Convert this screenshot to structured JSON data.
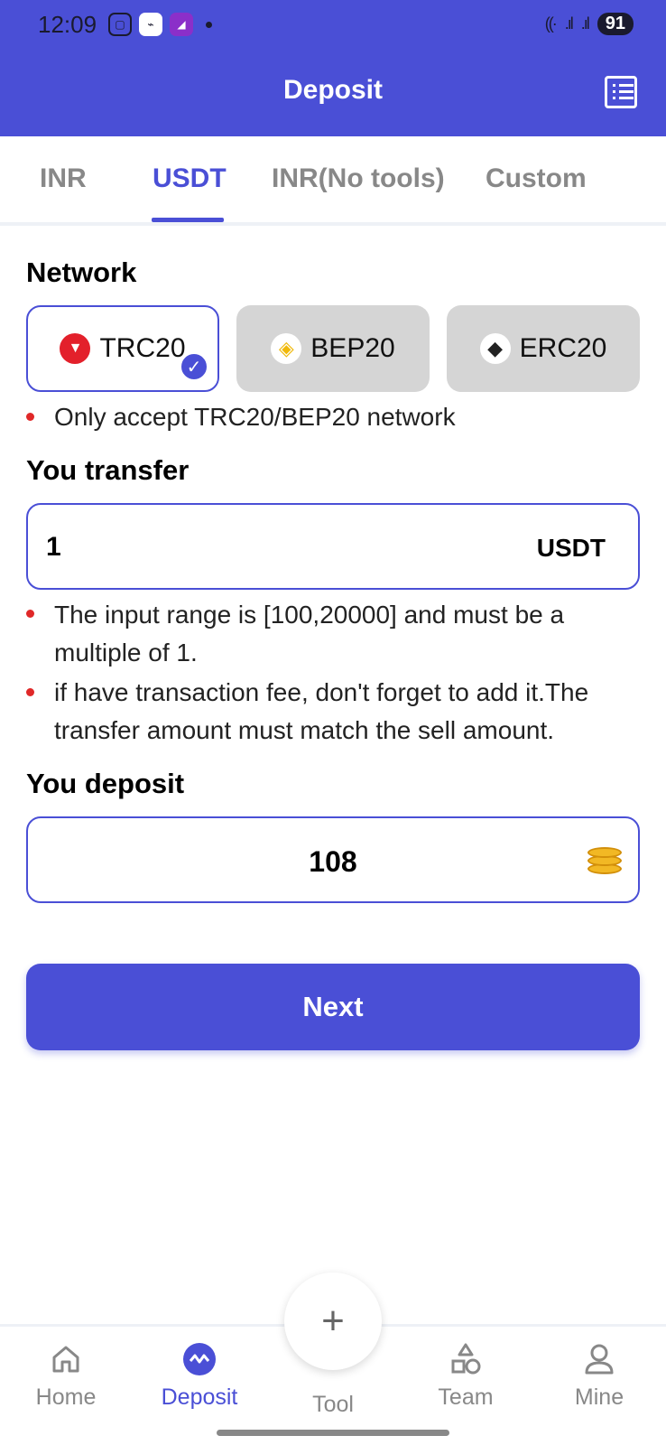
{
  "status_bar": {
    "time": "12:09",
    "battery": "91"
  },
  "header": {
    "title": "Deposit",
    "action_icon": "list-icon"
  },
  "tabs": [
    {
      "label": "INR",
      "active": false
    },
    {
      "label": "USDT",
      "active": true
    },
    {
      "label": "INR(No tools)",
      "active": false
    },
    {
      "label": "Custom",
      "active": false
    }
  ],
  "network": {
    "title": "Network",
    "options": [
      {
        "label": "TRC20",
        "icon": "tron-icon",
        "selected": true
      },
      {
        "label": "BEP20",
        "icon": "bnb-icon",
        "selected": false
      },
      {
        "label": "ERC20",
        "icon": "ethereum-icon",
        "selected": false
      }
    ],
    "note": "Only accept TRC20/BEP20 network"
  },
  "transfer": {
    "title": "You transfer",
    "value": "1",
    "unit": "USDT",
    "notes": [
      "The input range is [100,20000] and must be a multiple of 1.",
      "if have transaction fee, don't forget to add it.The transfer amount must match the sell amount."
    ]
  },
  "deposit": {
    "title": "You deposit",
    "value": "108",
    "icon": "coins-icon"
  },
  "next_button": "Next",
  "bottom_nav": [
    {
      "label": "Home",
      "icon": "home-icon",
      "active": false
    },
    {
      "label": "Deposit",
      "icon": "deposit-icon",
      "active": true
    },
    {
      "label": "Tool",
      "icon": "plus-icon",
      "active": false
    },
    {
      "label": "Team",
      "icon": "team-icon",
      "active": false
    },
    {
      "label": "Mine",
      "icon": "user-icon",
      "active": false
    }
  ],
  "colors": {
    "primary": "#4a4fd6",
    "bullet": "#e02828",
    "inactive_tab": "#888888",
    "network_card_bg": "#d5d5d5"
  }
}
